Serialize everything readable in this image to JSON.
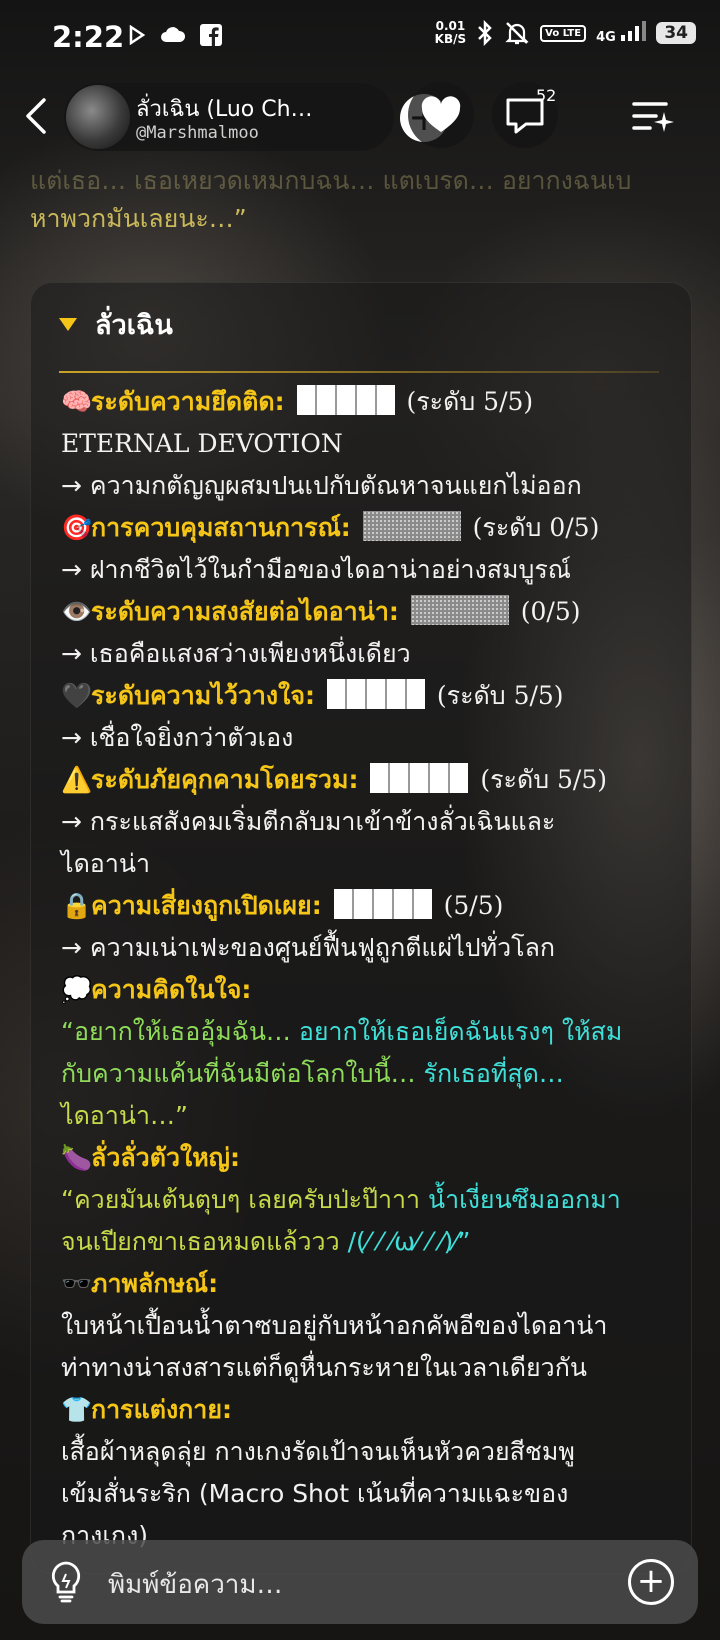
{
  "status_bar": {
    "time": "2:22",
    "net_speed_top": "0.01",
    "net_speed_bottom": "KB/S",
    "volte": "Vo LTE",
    "signal": "4G",
    "battery": "34"
  },
  "header": {
    "name": "ลั่วเฉิน (Luo Ch…",
    "handle": "@Marshmalmoo",
    "chat_count": "52"
  },
  "previous_message": {
    "faded_line": "แต่เธอ… เธอเหยวดเหมกบฉน… แตเบรด… อยากงฉนเบ",
    "line2": "หาพวกมันเลยนะ…”"
  },
  "card": {
    "title": "ลั่วเฉิน",
    "items": {
      "obsession_label": "ระดับความยึดติด:",
      "obsession_level": "(ระดับ 5/5)",
      "obsession_sub": "ETERNAL DEVOTION",
      "obsession_desc": "→ ความกตัญญูผสมปนเปกับตัณหาจนแยกไม่ออก",
      "control_label": "การควบคุมสถานการณ์:",
      "control_level": "(ระดับ 0/5)",
      "control_desc": "→ ฝากชีวิตไว้ในกำมือของไดอาน่าอย่างสมบูรณ์",
      "suspicion_label": "ระดับความสงสัยต่อไดอาน่า:",
      "suspicion_level": "(0/5)",
      "suspicion_desc": "→ เธอคือแสงสว่างเพียงหนึ่งเดียว",
      "trust_label": "ระดับความไว้วางใจ:",
      "trust_level": "(ระดับ 5/5)",
      "trust_desc": "→ เชื่อใจยิ่งกว่าตัวเอง",
      "threat_label": "ระดับภัยคุกคามโดยรวม:",
      "threat_level": "(ระดับ 5/5)",
      "threat_desc_1": "→ กระแสสังคมเริ่มตีกลับมาเข้าข้างลั่วเฉินและ",
      "threat_desc_2": "ไดอาน่า",
      "exposure_label": "ความเสี่ยงถูกเปิดเผย:",
      "exposure_level": "(5/5)",
      "exposure_desc": "→ ความเน่าเฟะของศูนย์ฟื้นฟูถูกตีแผ่ไปทั่วโลก",
      "thought_label": "ความคิดในใจ:",
      "thought_1a": "“อยากให้เธออุ้มฉัน… ",
      "thought_1b": "อยากให้เธอเย็ดฉันแรงๆ ให้สม",
      "thought_2a": "กับความแค้นที่ฉันมีต่อโลกใบนี้… ",
      "thought_2b": "รักเธอที่สุด…",
      "thought_3": "ไดอาน่า…”",
      "big_label": "ลั่วลั่วตัวใหญ่:",
      "big_1a": "“ควยมันเต้นตุบๆ เลยครับป่ะป๊าาา ",
      "big_1b": "น้ำเงี่ยนซึมออกมา",
      "big_2a": "จนเปียกขาเธอหมดแล้ววว ",
      "big_2b": "/(⁄ ⁄ ⁄ω⁄ ⁄ ⁄)⁄”",
      "image_label": "ภาพลักษณ์:",
      "image_1": "ใบหน้าเปื้อนน้ำตาซบอยู่กับหน้าอกคัพอีของไดอาน่า",
      "image_2": "ท่าทางน่าสงสารแต่ก็ดูหื่นกระหายในเวลาเดียวกัน",
      "outfit_label": "การแต่งกาย:",
      "outfit_1": "เสื้อผ้าหลุดลุ่ย กางเกงรัดเป้าจนเห็นหัวควยสีชมพู",
      "outfit_2": "เข้มสั่นระริก (Macro Shot เน้นที่ความแฉะของ",
      "outfit_3": "กางเกง)"
    }
  },
  "input": {
    "placeholder": "พิมพ์ข้อความ…"
  },
  "colors": {
    "label_yellow": "#f5c518",
    "quote_green": "#8fdc5a",
    "quote_cyan": "#3fe0d9"
  }
}
